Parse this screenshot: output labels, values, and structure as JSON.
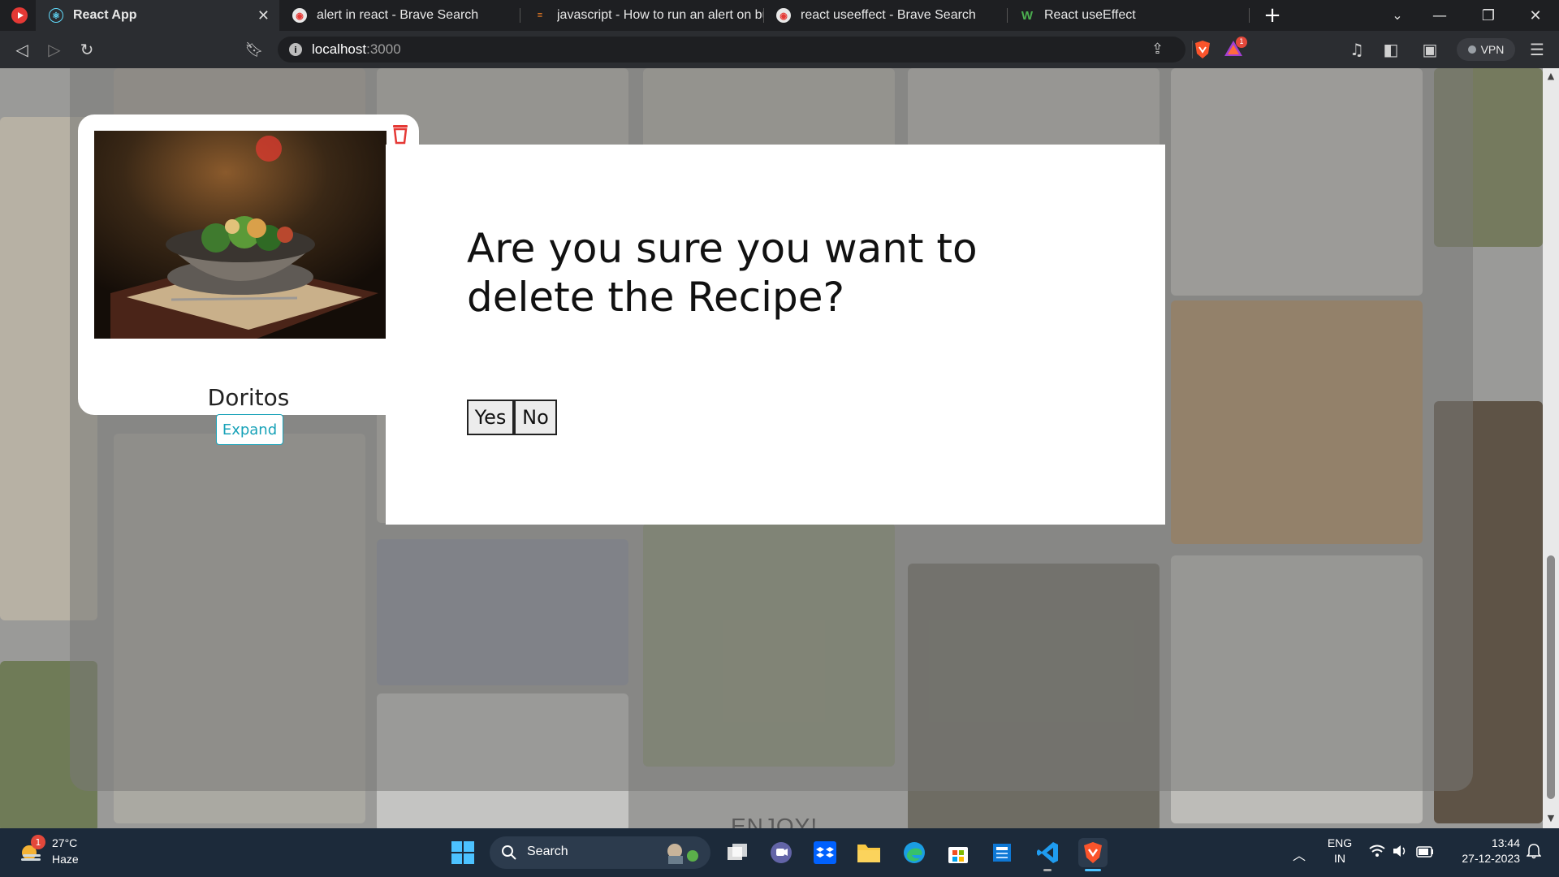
{
  "browser": {
    "tabs": [
      {
        "title": "React App",
        "active": true
      },
      {
        "title": "alert in react - Brave Search",
        "active": false
      },
      {
        "title": "javascript - How to run an alert on but",
        "active": false
      },
      {
        "title": "react useeffect - Brave Search",
        "active": false
      },
      {
        "title": "React useEffect",
        "active": false
      }
    ],
    "url": {
      "host": "localhost",
      "port": ":3000"
    },
    "vpn_label": "VPN",
    "brave_rewards_badge": "1",
    "icons": [
      "back-icon",
      "forward-icon",
      "reload-icon",
      "bookmark-icon",
      "share-icon",
      "brave-shield-icon",
      "rewards-icon",
      "media-icon",
      "sidebar-icon",
      "wallet-icon",
      "menu-icon"
    ]
  },
  "recipe_card": {
    "name": "Doritos",
    "expand_label": "Expand"
  },
  "modal": {
    "question": "Are you sure you want to delete the Recipe?",
    "yes_label": "Yes",
    "no_label": "No"
  },
  "page": {
    "footer_text": "ENJOY!"
  },
  "taskbar": {
    "weather": {
      "temp": "27°C",
      "condition": "Haze",
      "badge": "1"
    },
    "search_label": "Search",
    "language": {
      "line1": "ENG",
      "line2": "IN"
    },
    "time": "13:44",
    "date": "27-12-2023"
  },
  "colors": {
    "accent_teal": "#17a2b8",
    "trash_red": "#e53935",
    "taskbar_bg": "#1c2a3a"
  }
}
